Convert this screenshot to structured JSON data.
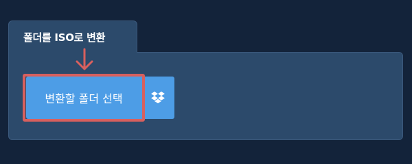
{
  "panel": {
    "title": "폴더를 ISO로 변환"
  },
  "actions": {
    "select_folder_label": "변환할 폴더 선택",
    "dropbox_icon": "dropbox-icon"
  },
  "annotation": {
    "highlight_color": "#d8605e",
    "arrow_icon": "arrow-down-icon"
  },
  "colors": {
    "background": "#13233a",
    "panel": "#2c4a6b",
    "button": "#4d9de6"
  }
}
